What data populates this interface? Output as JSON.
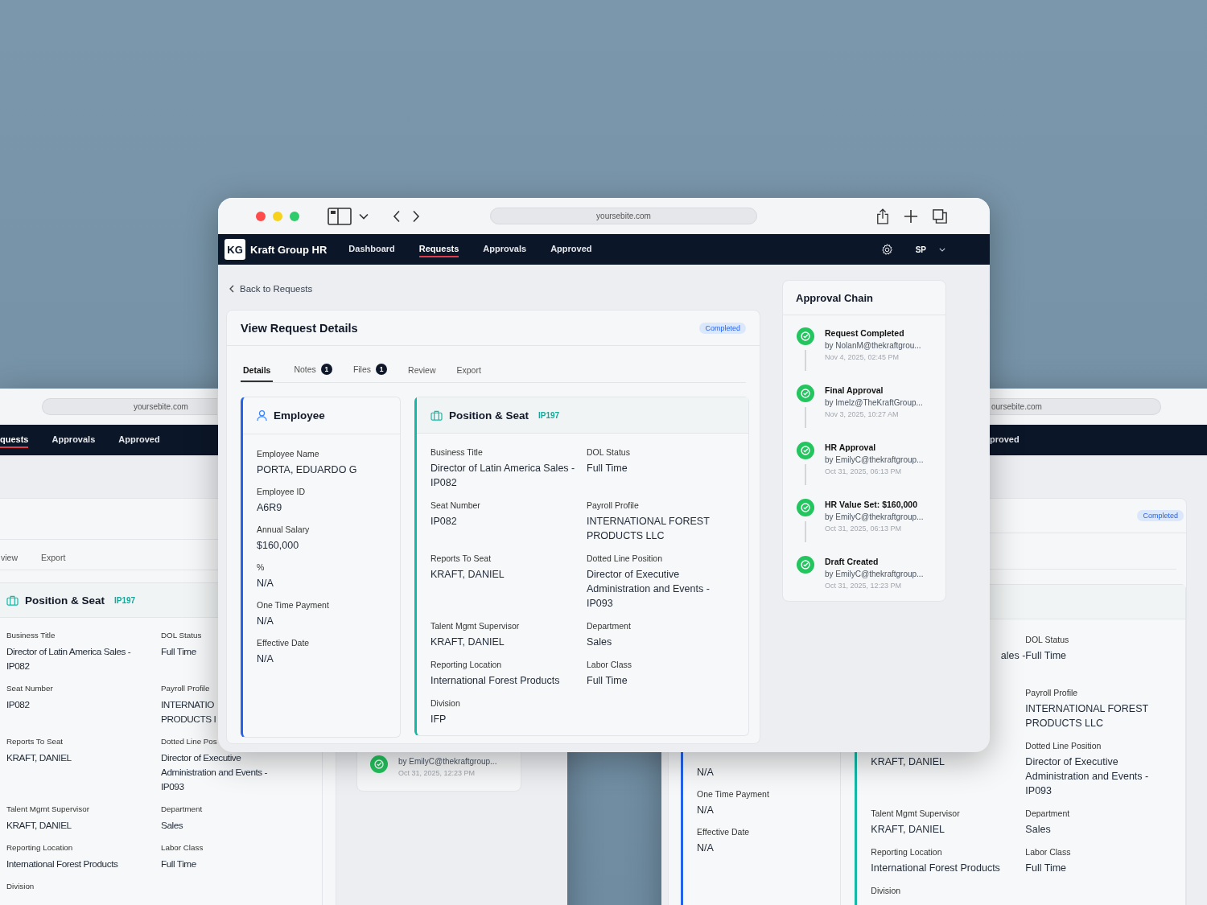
{
  "back_window_left": {
    "url": "yoursebite.com",
    "nav": [
      {
        "label": "quests",
        "selected": true
      },
      {
        "label": "Approvals",
        "selected": false
      },
      {
        "label": "Approved",
        "selected": false
      }
    ],
    "tabs": [
      {
        "label": "view",
        "selected": false
      },
      {
        "label": "Export",
        "selected": false
      }
    ],
    "position": {
      "title": "Position & Seat",
      "code": "IP197",
      "rows": [
        {
          "left": {
            "label": "Business Title",
            "value": [
              "Director of Latin America Sales -",
              "IP082"
            ]
          },
          "right": {
            "label": "DOL Status",
            "value": [
              "Full Time"
            ]
          }
        },
        {
          "left": {
            "label": "Seat Number",
            "value": [
              "IP082"
            ]
          },
          "right": {
            "label": "Payroll Profile",
            "value": [
              "INTERNATIO",
              "PRODUCTS I"
            ]
          }
        },
        {
          "left": {
            "label": "Reports To Seat",
            "value": [
              "KRAFT, DANIEL"
            ]
          },
          "right": {
            "label": "Dotted Line Pos",
            "value": [
              "Director of Executive",
              "Administration and Events -",
              "IP093"
            ]
          }
        },
        {
          "left": {
            "label": "Talent Mgmt Supervisor",
            "value": [
              "KRAFT, DANIEL"
            ]
          },
          "right": {
            "label": "Department",
            "value": [
              "Sales"
            ]
          }
        },
        {
          "left": {
            "label": "Reporting Location",
            "value": [
              "International Forest Products"
            ]
          },
          "right": {
            "label": "Labor Class",
            "value": [
              "Full Time"
            ]
          }
        },
        {
          "left": {
            "label": "Division"
          }
        }
      ]
    },
    "approval_step": {
      "by": "by EmilyC@thekraftgroup...",
      "date": "Oct 31, 2025, 12:23 PM"
    }
  },
  "back_window_right": {
    "url": "oursebite.com",
    "nav": [
      {
        "label": "proved",
        "selected": false
      }
    ],
    "status": "Completed",
    "employee": {
      "fields": [
        {
          "value": [
            "N/A"
          ]
        },
        {
          "label": "One Time Payment",
          "value": [
            "N/A"
          ]
        },
        {
          "label": "Effective Date",
          "value": [
            "N/A"
          ]
        }
      ]
    },
    "position": {
      "rows": [
        {
          "left": {
            "value": [
              "ales -"
            ]
          },
          "right": {
            "label": "DOL Status",
            "value": [
              "Full Time"
            ]
          }
        },
        {
          "right": {
            "label": "Payroll Profile",
            "value": [
              "INTERNATIONAL FOREST",
              "PRODUCTS LLC"
            ]
          }
        },
        {
          "left": {
            "value": [
              "KRAFT, DANIEL"
            ]
          },
          "right": {
            "label": "Dotted Line Position",
            "value": [
              "Director of Executive",
              "Administration and Events -",
              "IP093"
            ]
          }
        },
        {
          "left": {
            "label": "Talent Mgmt Supervisor",
            "value": [
              "KRAFT, DANIEL"
            ]
          },
          "right": {
            "label": "Department",
            "value": [
              "Sales"
            ]
          }
        },
        {
          "left": {
            "label": "Reporting Location",
            "value": [
              "International Forest Products"
            ]
          },
          "right": {
            "label": "Labor Class",
            "value": [
              "Full Time"
            ]
          }
        },
        {
          "left": {
            "label": "Division"
          }
        }
      ]
    }
  },
  "main_window": {
    "url": "yoursebite.com",
    "app": {
      "logo": "KG",
      "name": "Kraft Group HR"
    },
    "nav": [
      {
        "label": "Dashboard",
        "selected": false
      },
      {
        "label": "Requests",
        "selected": true
      },
      {
        "label": "Approvals",
        "selected": false
      },
      {
        "label": "Approved",
        "selected": false
      }
    ],
    "user": "SP",
    "back_link": "Back to Requests",
    "request": {
      "title": "View Request Details",
      "status": "Completed",
      "tabs": [
        {
          "label": "Details",
          "selected": true
        },
        {
          "label": "Notes",
          "count": "1",
          "selected": false
        },
        {
          "label": "Files",
          "count": "1",
          "selected": false
        },
        {
          "label": "Review",
          "selected": false
        },
        {
          "label": "Export",
          "selected": false
        }
      ],
      "employee": {
        "title": "Employee",
        "fields": [
          {
            "label": "Employee Name",
            "value": [
              "PORTA, EDUARDO G"
            ]
          },
          {
            "label": "Employee ID",
            "value": [
              "A6R9"
            ]
          },
          {
            "label": "Annual Salary",
            "value": [
              "$160,000"
            ]
          },
          {
            "label": "%",
            "value": [
              "N/A"
            ]
          },
          {
            "label": "One Time Payment",
            "value": [
              "N/A"
            ]
          },
          {
            "label": "Effective Date",
            "value": [
              "N/A"
            ]
          }
        ]
      },
      "position": {
        "title": "Position & Seat",
        "code": "IP197",
        "rows": [
          {
            "left": {
              "label": "Business Title",
              "value": [
                "Director of Latin America Sales -",
                "IP082"
              ]
            },
            "right": {
              "label": "DOL Status",
              "value": [
                "Full Time"
              ]
            }
          },
          {
            "left": {
              "label": "Seat Number",
              "value": [
                "IP082"
              ]
            },
            "right": {
              "label": "Payroll Profile",
              "value": [
                "INTERNATIONAL FOREST",
                "PRODUCTS LLC"
              ]
            }
          },
          {
            "left": {
              "label": "Reports To Seat",
              "value": [
                "KRAFT, DANIEL"
              ]
            },
            "right": {
              "label": "Dotted Line Position",
              "value": [
                "Director of Executive",
                "Administration and Events -",
                "IP093"
              ]
            }
          },
          {
            "left": {
              "label": "Talent Mgmt Supervisor",
              "value": [
                "KRAFT, DANIEL"
              ]
            },
            "right": {
              "label": "Department",
              "value": [
                "Sales"
              ]
            }
          },
          {
            "left": {
              "label": "Reporting Location",
              "value": [
                "International Forest Products"
              ]
            },
            "right": {
              "label": "Labor Class",
              "value": [
                "Full Time"
              ]
            }
          },
          {
            "left": {
              "label": "Division",
              "value": [
                "IFP"
              ]
            }
          }
        ]
      }
    },
    "approval_chain": {
      "title": "Approval Chain",
      "steps": [
        {
          "title": "Request Completed",
          "by": "by NolanM@thekraftgrou...",
          "date": "Nov 4, 2025, 02:45 PM"
        },
        {
          "title": "Final Approval",
          "by": "by Imelz@TheKraftGroup...",
          "date": "Nov 3, 2025, 10:27 AM"
        },
        {
          "title": "HR Approval",
          "by": "by EmilyC@thekraftgroup...",
          "date": "Oct 31, 2025, 06:13 PM"
        },
        {
          "title": "HR Value Set: $160,000",
          "by": "by EmilyC@thekraftgroup...",
          "date": "Oct 31, 2025, 06:13 PM"
        },
        {
          "title": "Draft Created",
          "by": "by EmilyC@thekraftgroup...",
          "date": "Oct 31, 2025, 12:23 PM"
        }
      ]
    }
  }
}
